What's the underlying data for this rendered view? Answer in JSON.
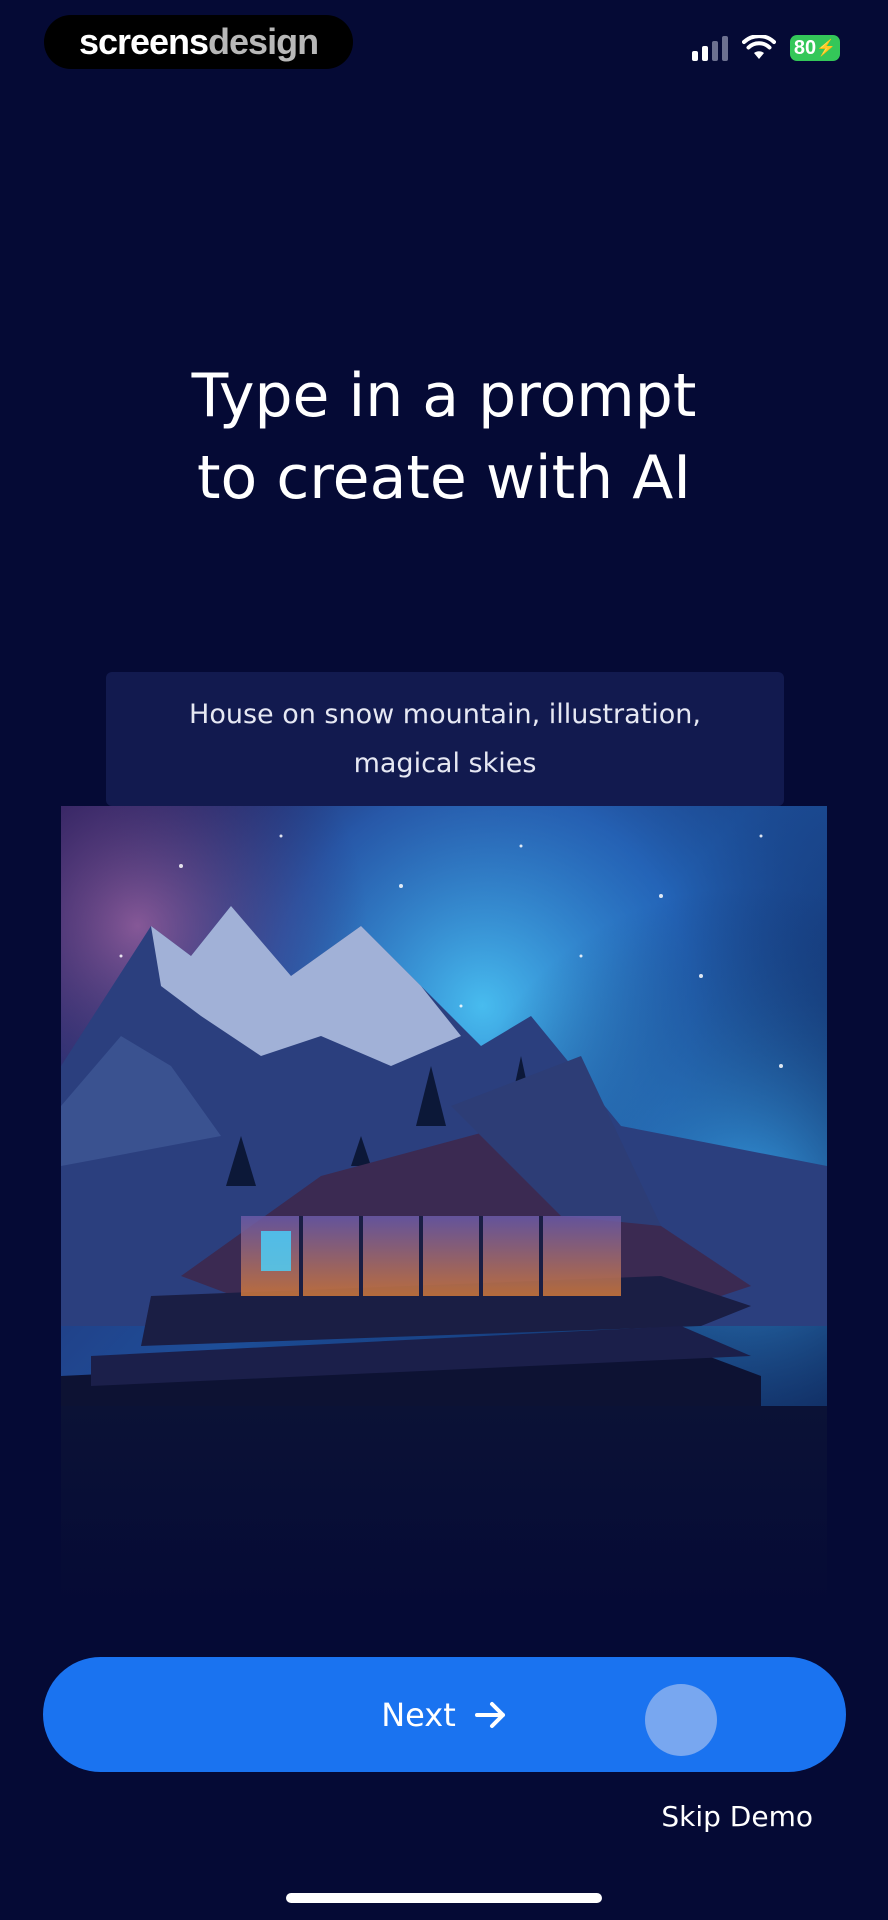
{
  "watermark": {
    "part_a": "screens",
    "part_b": "design"
  },
  "status_bar": {
    "battery": "80",
    "icons": [
      "signal-icon",
      "wifi-icon",
      "battery-charging-icon"
    ]
  },
  "onboarding": {
    "title_line_1": "Type in a prompt",
    "title_line_2": "to create with AI",
    "prompt_example": "House on snow mountain, illustration, magical skies"
  },
  "actions": {
    "next_label": "Next",
    "next_icon": "arrow-right-icon",
    "skip_label": "Skip Demo"
  },
  "colors": {
    "background": "#050a35",
    "prompt_box": "#121a4f",
    "accent": "#1a73f0",
    "battery": "#34c759"
  }
}
